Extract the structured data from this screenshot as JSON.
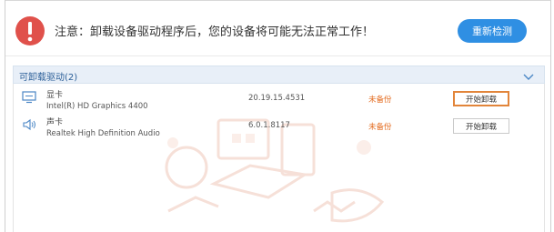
{
  "warning": {
    "message": "注意：卸载设备驱动程序后，您的设备将可能无法正常工作！",
    "rescan_label": "重新检测"
  },
  "section": {
    "title": "可卸载驱动(2)"
  },
  "devices": [
    {
      "category": "显卡",
      "name": "Intel(R) HD Graphics 4400",
      "version": "20.19.15.4531",
      "status": "未备份",
      "action": "开始卸载",
      "icon": "display-icon"
    },
    {
      "category": "声卡",
      "name": "Realtek High Definition Audio",
      "version": "6.0.1.8117",
      "status": "未备份",
      "action": "开始卸载",
      "icon": "speaker-icon"
    }
  ],
  "colors": {
    "warning_red": "#e0514b",
    "primary_blue": "#2f8fe3",
    "status_orange": "#e36b1f",
    "highlight_orange": "#e2853a",
    "header_bg": "#e8eff8"
  }
}
